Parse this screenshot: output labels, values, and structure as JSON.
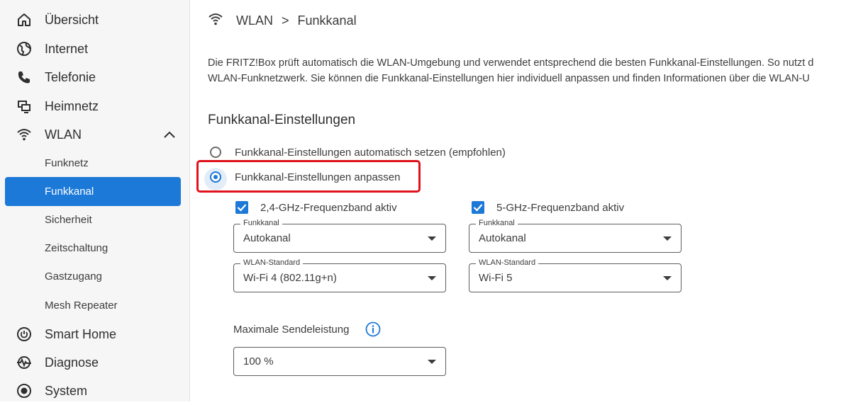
{
  "sidebar": {
    "items": [
      {
        "label": "Übersicht",
        "icon": "home-icon"
      },
      {
        "label": "Internet",
        "icon": "globe-icon"
      },
      {
        "label": "Telefonie",
        "icon": "phone-icon"
      },
      {
        "label": "Heimnetz",
        "icon": "network-icon"
      },
      {
        "label": "WLAN",
        "icon": "wifi-icon"
      }
    ],
    "wlan_sub": [
      {
        "label": "Funknetz"
      },
      {
        "label": "Funkkanal"
      },
      {
        "label": "Sicherheit"
      },
      {
        "label": "Zeitschaltung"
      },
      {
        "label": "Gastzugang"
      },
      {
        "label": "Mesh Repeater"
      }
    ],
    "bottom_items": [
      {
        "label": "Smart Home",
        "icon": "power-icon"
      },
      {
        "label": "Diagnose",
        "icon": "diagnose-icon"
      },
      {
        "label": "System",
        "icon": "system-icon"
      }
    ]
  },
  "breadcrumb": {
    "section": "WLAN",
    "separator": ">",
    "page": "Funkkanal"
  },
  "intro": {
    "line1": "Die FRITZ!Box prüft automatisch die WLAN-Umgebung und verwendet entsprechend die besten Funkkanal-Einstellungen. So nutzt d",
    "line2": "WLAN-Funknetzwerk. Sie können die Funkkanal-Einstellungen hier individuell anpassen und finden Informationen über die WLAN-U"
  },
  "settings": {
    "title": "Funkkanal-Einstellungen",
    "radio_auto": "Funkkanal-Einstellungen automatisch setzen (empfohlen)",
    "radio_custom": "Funkkanal-Einstellungen anpassen",
    "band24": {
      "label": "2,4-GHz-Frequenzband aktiv",
      "channel_legend": "Funkkanal",
      "channel_value": "Autokanal",
      "standard_legend": "WLAN-Standard",
      "standard_value": "Wi-Fi 4 (802.11g+n)"
    },
    "band5": {
      "label": "5-GHz-Frequenzband aktiv",
      "channel_legend": "Funkkanal",
      "channel_value": "Autokanal",
      "standard_legend": "WLAN-Standard",
      "standard_value": "Wi-Fi 5"
    },
    "power_label": "Maximale Sendeleistung",
    "power_value": "100 %"
  },
  "colors": {
    "accent": "#1c79d8",
    "highlight": "#e0121b"
  }
}
